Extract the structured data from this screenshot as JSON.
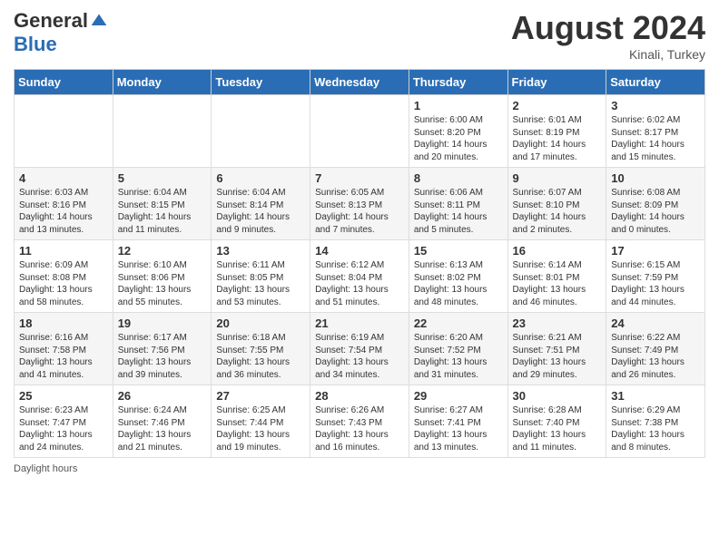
{
  "header": {
    "logo_general": "General",
    "logo_blue": "Blue",
    "month_title": "August 2024",
    "location": "Kinali, Turkey"
  },
  "days_of_week": [
    "Sunday",
    "Monday",
    "Tuesday",
    "Wednesday",
    "Thursday",
    "Friday",
    "Saturday"
  ],
  "weeks": [
    [
      {
        "day": "",
        "info": ""
      },
      {
        "day": "",
        "info": ""
      },
      {
        "day": "",
        "info": ""
      },
      {
        "day": "",
        "info": ""
      },
      {
        "day": "1",
        "info": "Sunrise: 6:00 AM\nSunset: 8:20 PM\nDaylight: 14 hours\nand 20 minutes."
      },
      {
        "day": "2",
        "info": "Sunrise: 6:01 AM\nSunset: 8:19 PM\nDaylight: 14 hours\nand 17 minutes."
      },
      {
        "day": "3",
        "info": "Sunrise: 6:02 AM\nSunset: 8:17 PM\nDaylight: 14 hours\nand 15 minutes."
      }
    ],
    [
      {
        "day": "4",
        "info": "Sunrise: 6:03 AM\nSunset: 8:16 PM\nDaylight: 14 hours\nand 13 minutes."
      },
      {
        "day": "5",
        "info": "Sunrise: 6:04 AM\nSunset: 8:15 PM\nDaylight: 14 hours\nand 11 minutes."
      },
      {
        "day": "6",
        "info": "Sunrise: 6:04 AM\nSunset: 8:14 PM\nDaylight: 14 hours\nand 9 minutes."
      },
      {
        "day": "7",
        "info": "Sunrise: 6:05 AM\nSunset: 8:13 PM\nDaylight: 14 hours\nand 7 minutes."
      },
      {
        "day": "8",
        "info": "Sunrise: 6:06 AM\nSunset: 8:11 PM\nDaylight: 14 hours\nand 5 minutes."
      },
      {
        "day": "9",
        "info": "Sunrise: 6:07 AM\nSunset: 8:10 PM\nDaylight: 14 hours\nand 2 minutes."
      },
      {
        "day": "10",
        "info": "Sunrise: 6:08 AM\nSunset: 8:09 PM\nDaylight: 14 hours\nand 0 minutes."
      }
    ],
    [
      {
        "day": "11",
        "info": "Sunrise: 6:09 AM\nSunset: 8:08 PM\nDaylight: 13 hours\nand 58 minutes."
      },
      {
        "day": "12",
        "info": "Sunrise: 6:10 AM\nSunset: 8:06 PM\nDaylight: 13 hours\nand 55 minutes."
      },
      {
        "day": "13",
        "info": "Sunrise: 6:11 AM\nSunset: 8:05 PM\nDaylight: 13 hours\nand 53 minutes."
      },
      {
        "day": "14",
        "info": "Sunrise: 6:12 AM\nSunset: 8:04 PM\nDaylight: 13 hours\nand 51 minutes."
      },
      {
        "day": "15",
        "info": "Sunrise: 6:13 AM\nSunset: 8:02 PM\nDaylight: 13 hours\nand 48 minutes."
      },
      {
        "day": "16",
        "info": "Sunrise: 6:14 AM\nSunset: 8:01 PM\nDaylight: 13 hours\nand 46 minutes."
      },
      {
        "day": "17",
        "info": "Sunrise: 6:15 AM\nSunset: 7:59 PM\nDaylight: 13 hours\nand 44 minutes."
      }
    ],
    [
      {
        "day": "18",
        "info": "Sunrise: 6:16 AM\nSunset: 7:58 PM\nDaylight: 13 hours\nand 41 minutes."
      },
      {
        "day": "19",
        "info": "Sunrise: 6:17 AM\nSunset: 7:56 PM\nDaylight: 13 hours\nand 39 minutes."
      },
      {
        "day": "20",
        "info": "Sunrise: 6:18 AM\nSunset: 7:55 PM\nDaylight: 13 hours\nand 36 minutes."
      },
      {
        "day": "21",
        "info": "Sunrise: 6:19 AM\nSunset: 7:54 PM\nDaylight: 13 hours\nand 34 minutes."
      },
      {
        "day": "22",
        "info": "Sunrise: 6:20 AM\nSunset: 7:52 PM\nDaylight: 13 hours\nand 31 minutes."
      },
      {
        "day": "23",
        "info": "Sunrise: 6:21 AM\nSunset: 7:51 PM\nDaylight: 13 hours\nand 29 minutes."
      },
      {
        "day": "24",
        "info": "Sunrise: 6:22 AM\nSunset: 7:49 PM\nDaylight: 13 hours\nand 26 minutes."
      }
    ],
    [
      {
        "day": "25",
        "info": "Sunrise: 6:23 AM\nSunset: 7:47 PM\nDaylight: 13 hours\nand 24 minutes."
      },
      {
        "day": "26",
        "info": "Sunrise: 6:24 AM\nSunset: 7:46 PM\nDaylight: 13 hours\nand 21 minutes."
      },
      {
        "day": "27",
        "info": "Sunrise: 6:25 AM\nSunset: 7:44 PM\nDaylight: 13 hours\nand 19 minutes."
      },
      {
        "day": "28",
        "info": "Sunrise: 6:26 AM\nSunset: 7:43 PM\nDaylight: 13 hours\nand 16 minutes."
      },
      {
        "day": "29",
        "info": "Sunrise: 6:27 AM\nSunset: 7:41 PM\nDaylight: 13 hours\nand 13 minutes."
      },
      {
        "day": "30",
        "info": "Sunrise: 6:28 AM\nSunset: 7:40 PM\nDaylight: 13 hours\nand 11 minutes."
      },
      {
        "day": "31",
        "info": "Sunrise: 6:29 AM\nSunset: 7:38 PM\nDaylight: 13 hours\nand 8 minutes."
      }
    ]
  ],
  "footer": {
    "daylight_hours": "Daylight hours"
  }
}
